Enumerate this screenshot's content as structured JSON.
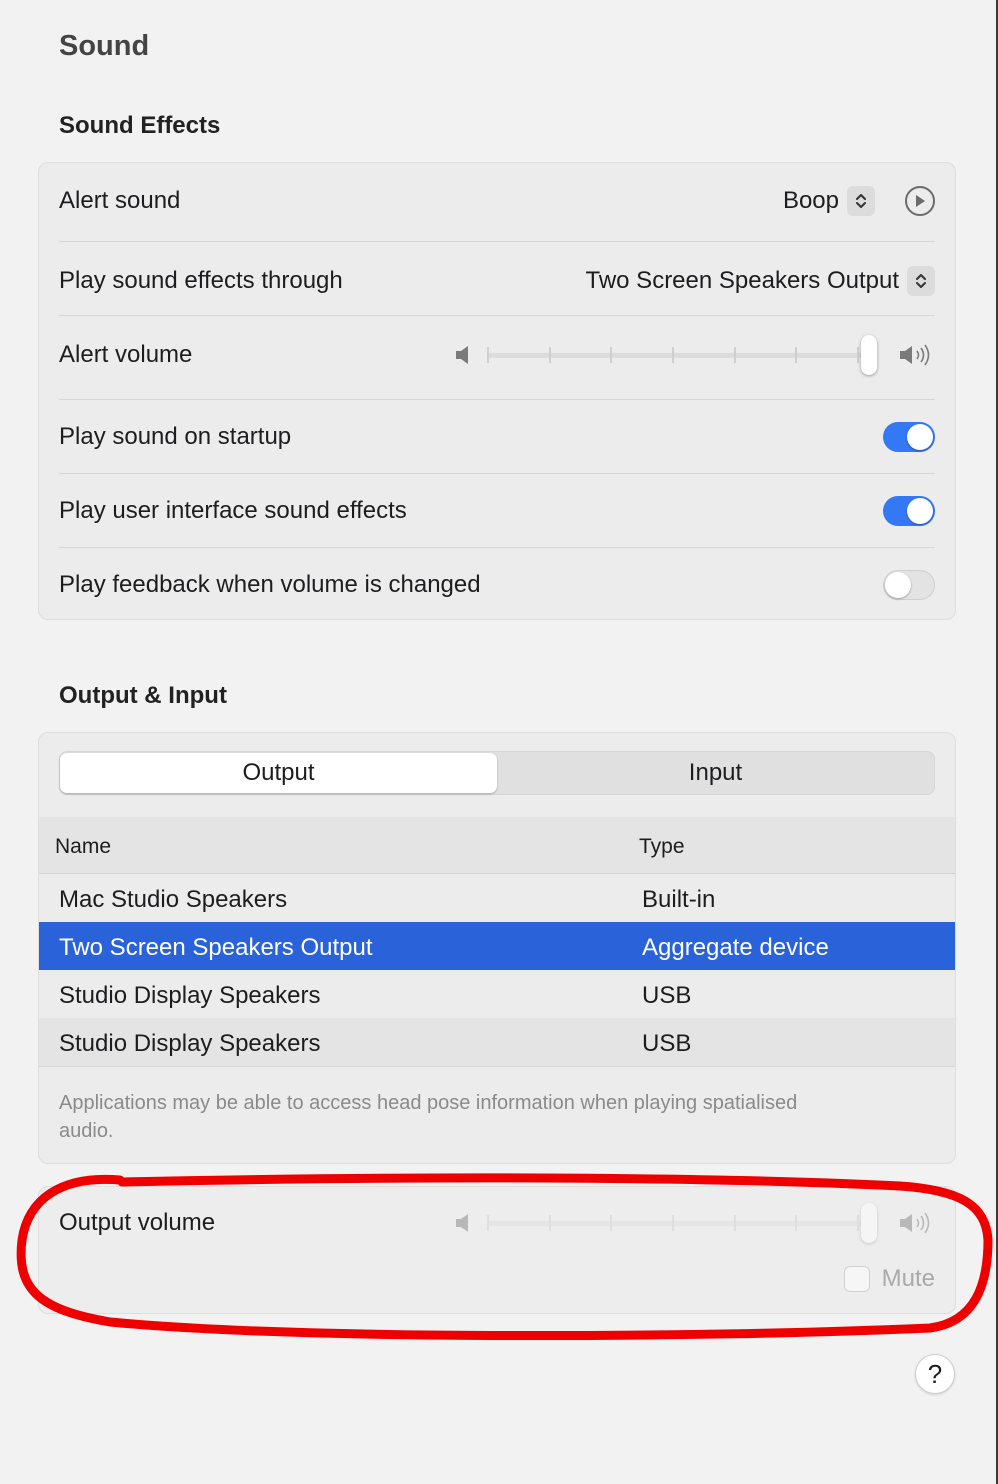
{
  "page_title": "Sound",
  "sound_effects": {
    "heading": "Sound Effects",
    "alert_sound": {
      "label": "Alert sound",
      "value": "Boop"
    },
    "play_through": {
      "label": "Play sound effects through",
      "value": "Two Screen Speakers Output"
    },
    "alert_volume": {
      "label": "Alert volume",
      "level": 1.0
    },
    "startup": {
      "label": "Play sound on startup",
      "on": true
    },
    "ui_effects": {
      "label": "Play user interface sound effects",
      "on": true
    },
    "feedback": {
      "label": "Play feedback when volume is changed",
      "on": false
    }
  },
  "output_input": {
    "heading": "Output & Input",
    "tabs": [
      "Output",
      "Input"
    ],
    "selected_tab": "Output",
    "columns": [
      "Name",
      "Type"
    ],
    "devices": [
      {
        "name": "Mac Studio Speakers",
        "type": "Built-in"
      },
      {
        "name": "Two Screen Speakers Output",
        "type": "Aggregate device"
      },
      {
        "name": "Studio Display Speakers",
        "type": "USB"
      },
      {
        "name": "Studio Display Speakers",
        "type": "USB"
      }
    ],
    "selected_device_index": 1,
    "note": "Applications may be able to access head pose information when playing spatialised audio."
  },
  "output_volume": {
    "label": "Output volume",
    "level": 1.0,
    "mute_label": "Mute",
    "muted": false
  },
  "help_label": "?",
  "colors": {
    "accent": "#3478f6",
    "selection": "#2a63d9",
    "annotation": "#ee0000"
  }
}
